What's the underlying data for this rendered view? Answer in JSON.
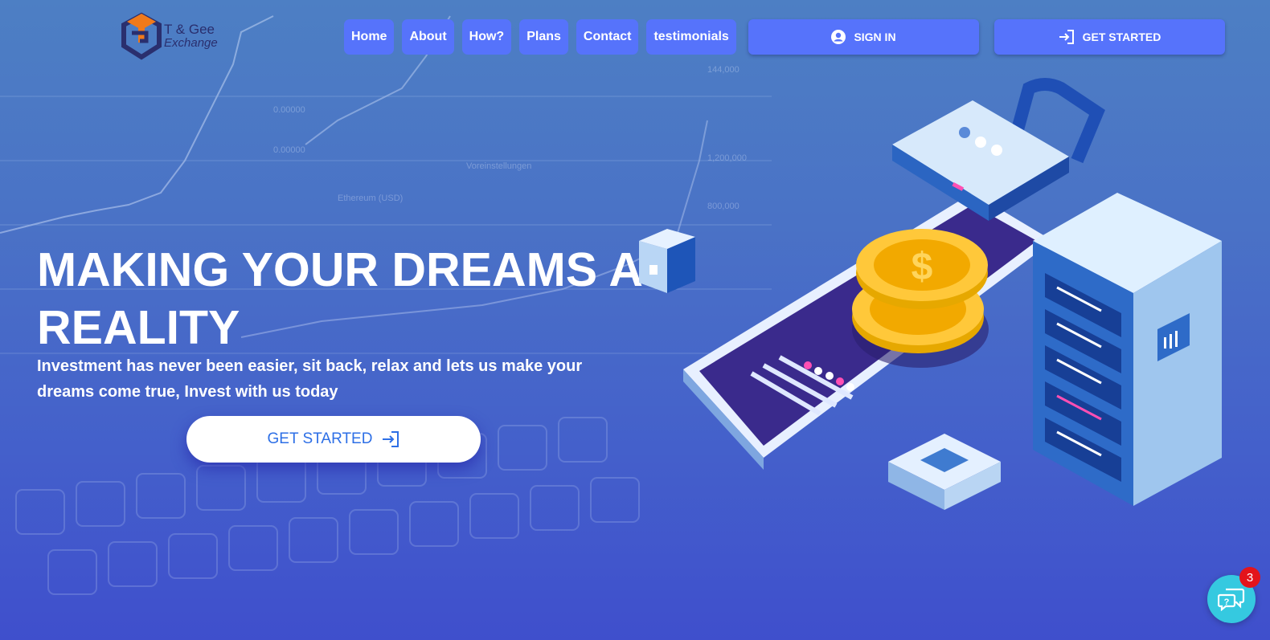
{
  "brand": {
    "line1": "T & Gee",
    "line2": "Exchange"
  },
  "nav": [
    {
      "label": "Home"
    },
    {
      "label": "About"
    },
    {
      "label": "How?"
    },
    {
      "label": "Plans"
    },
    {
      "label": "Contact"
    },
    {
      "label": "testimonials"
    }
  ],
  "header_actions": {
    "signin_label": "SIGN IN",
    "getstarted_label": "GET STARTED"
  },
  "hero": {
    "title": "MAKING YOUR DREAMS A REALITY",
    "subtitle": "Investment has never been easier, sit back, relax and lets us make your dreams come true, Invest with us today",
    "cta_label": "GET STARTED"
  },
  "chat": {
    "badge_count": "3"
  },
  "colors": {
    "accent": "#5673fb",
    "cta_text": "#2d6fe6",
    "chat": "#35c9e0",
    "badge": "#e3141b"
  },
  "icons": [
    "user-circle-icon",
    "sign-in-icon",
    "chat-question-icon"
  ]
}
